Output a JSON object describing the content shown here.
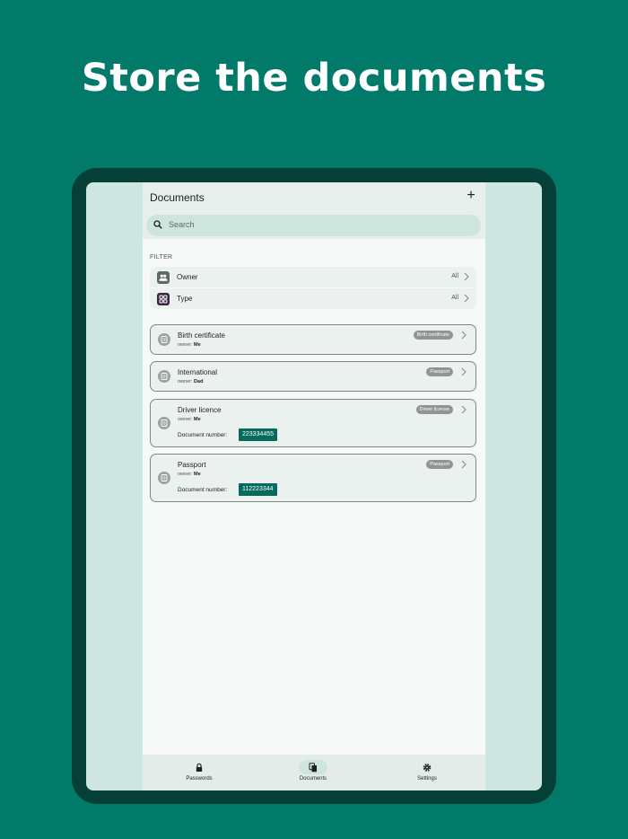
{
  "headline": "Store the documents",
  "appbar": {
    "title": "Documents",
    "add_icon": "plus-icon"
  },
  "search": {
    "placeholder": "Search"
  },
  "filter": {
    "label": "FILTER",
    "rows": [
      {
        "label": "Owner",
        "value": "All",
        "icon": "people-icon",
        "color": "#5c6b66"
      },
      {
        "label": "Type",
        "value": "All",
        "icon": "grid-icon",
        "color": "#3b2442"
      }
    ]
  },
  "documents": [
    {
      "title": "Birth certificate",
      "owner_prefix": "owner:",
      "owner": "Me",
      "badge": "Birth certificate"
    },
    {
      "title": "International",
      "owner_prefix": "owner:",
      "owner": "Dad",
      "badge": "Passport"
    },
    {
      "title": "Driver licence",
      "owner_prefix": "owner:",
      "owner": "Me",
      "badge": "Driver license",
      "docnum_label": "Document number:",
      "docnum": "223334455"
    },
    {
      "title": "Passport",
      "owner_prefix": "owner:",
      "owner": "Me",
      "badge": "Passport",
      "docnum_label": "Document number:",
      "docnum": "112223344"
    }
  ],
  "nav": [
    {
      "label": "Passwords",
      "icon": "lock-icon",
      "active": false
    },
    {
      "label": "Documents",
      "icon": "documents-icon",
      "active": true
    },
    {
      "label": "Settings",
      "icon": "gear-icon",
      "active": false
    }
  ],
  "colors": {
    "background": "#027a6a",
    "tablet_frame": "#063f37",
    "accent": "#046b5d"
  }
}
